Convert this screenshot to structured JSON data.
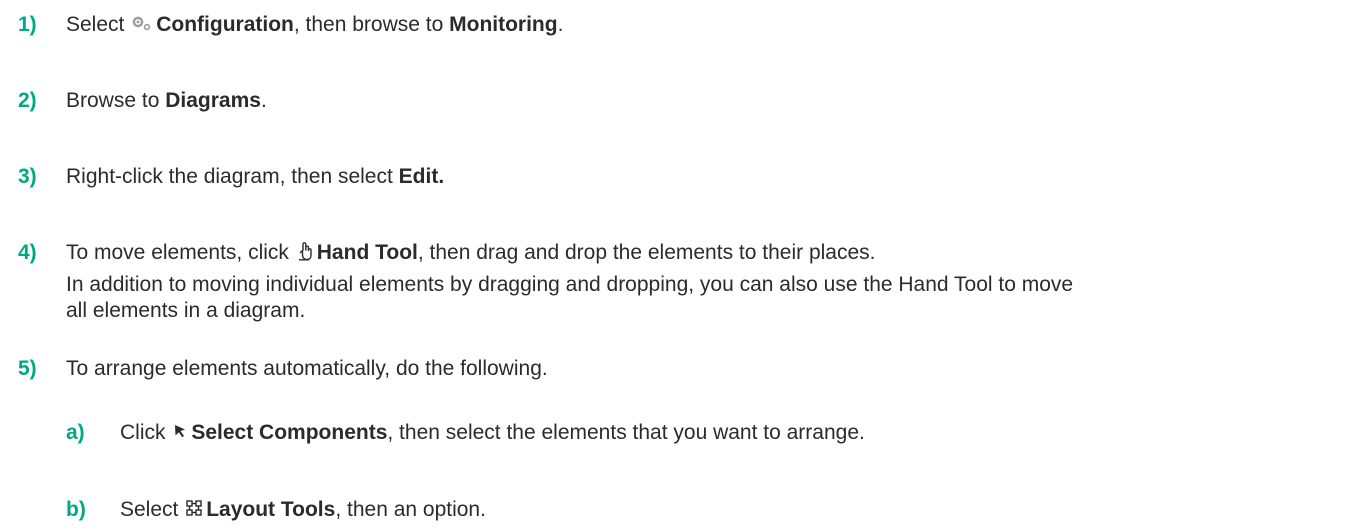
{
  "steps": [
    {
      "number": "1)",
      "pre": "Select",
      "icon": "gear-icon",
      "bold1": "Configuration",
      "mid": ", then browse to",
      "bold2": "Monitoring",
      "post": "."
    },
    {
      "number": "2)",
      "pre": "Browse to",
      "bold1": "Diagrams",
      "post": "."
    },
    {
      "number": "3)",
      "pre": "Right-click the diagram, then select",
      "bold1": "Edit."
    },
    {
      "number": "4)",
      "pre": "To move elements, click",
      "icon": "hand-icon",
      "bold1": "Hand Tool",
      "post": ", then drag and drop the elements to their places.",
      "note_line1": "In addition to moving individual elements by dragging and dropping, you can also use the Hand Tool to move",
      "note_line2": "all elements in a diagram."
    },
    {
      "number": "5)",
      "pre": "To arrange elements automatically, do the following."
    }
  ],
  "substeps": [
    {
      "letter": "a)",
      "pre": "Click",
      "icon": "cursor-arrow-icon",
      "bold1": "Select Components",
      "post": ", then select the elements that you want to arrange."
    },
    {
      "letter": "b)",
      "pre": "Select",
      "icon": "layout-grid-icon",
      "bold1": "Layout Tools",
      "post": ", then an option."
    }
  ],
  "colors": {
    "step_number": "#01a982",
    "text": "#2b2b2b"
  }
}
